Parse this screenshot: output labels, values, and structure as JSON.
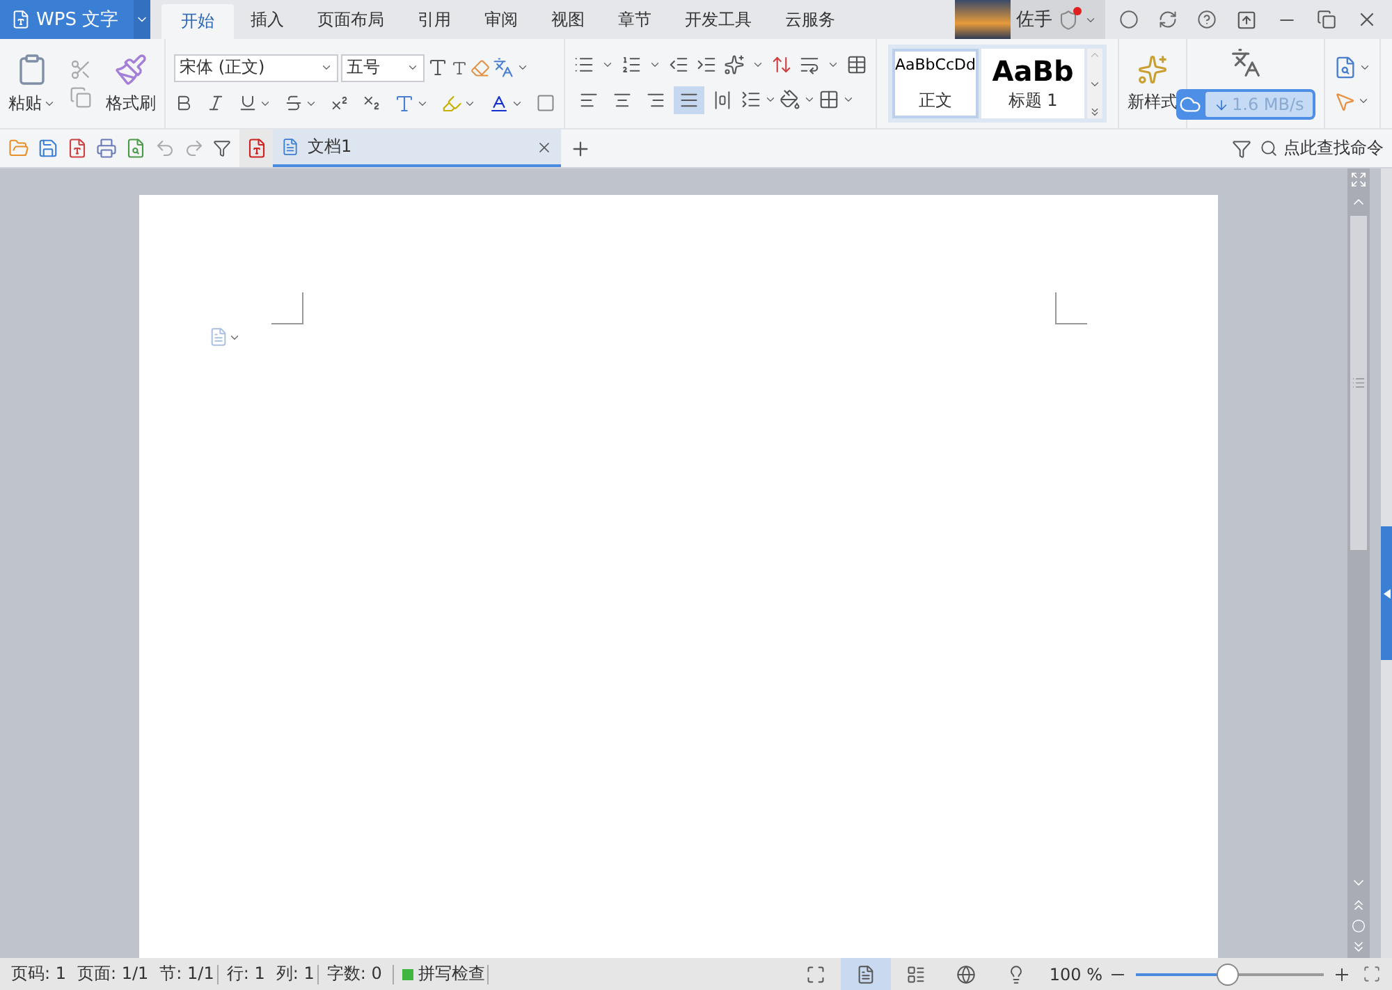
{
  "app_menu": {
    "label": "WPS 文字"
  },
  "tabs": [
    {
      "label": "开始",
      "selected": true
    },
    {
      "label": "插入",
      "selected": false
    },
    {
      "label": "页面布局",
      "selected": false
    },
    {
      "label": "引用",
      "selected": false
    },
    {
      "label": "审阅",
      "selected": false
    },
    {
      "label": "视图",
      "selected": false
    },
    {
      "label": "章节",
      "selected": false
    },
    {
      "label": "开发工具",
      "selected": false
    },
    {
      "label": "云服务",
      "selected": false
    }
  ],
  "user": {
    "name": "佐手",
    "notification": true
  },
  "ribbon": {
    "paste": "粘贴",
    "format_painter": "格式刷",
    "font_name": "宋体 (正文)",
    "font_size": "五号",
    "alignment": [
      {
        "kind": "left",
        "selected": false
      },
      {
        "kind": "center",
        "selected": false
      },
      {
        "kind": "right",
        "selected": false
      },
      {
        "kind": "justify",
        "selected": true
      },
      {
        "kind": "distributed",
        "selected": false
      }
    ],
    "styles": [
      {
        "preview": "AaBbCcDd",
        "label": "正文",
        "selected": true,
        "kind": "body"
      },
      {
        "preview": "AaBb",
        "label": "标题 1",
        "selected": false,
        "kind": "heading"
      }
    ],
    "new_style": "新样式",
    "download_speed": "1.6 MB/s"
  },
  "doc_tabs": [
    {
      "title": "文档1",
      "selected": true
    }
  ],
  "command_search": {
    "placeholder": "点此查找命令"
  },
  "status_bar": {
    "items": [
      "页码: 1",
      "页面: 1/1",
      "节: 1/1",
      "行: 1",
      "列: 1",
      "字数: 0"
    ],
    "spell_check": "拼写检查",
    "view_buttons": [
      {
        "kind": "fullscreen",
        "selected": false
      },
      {
        "kind": "page",
        "selected": true
      },
      {
        "kind": "outline",
        "selected": false
      },
      {
        "kind": "web",
        "selected": false
      },
      {
        "kind": "eye",
        "selected": false
      }
    ],
    "zoom": {
      "label": "100 %",
      "level": 0.49
    }
  }
}
